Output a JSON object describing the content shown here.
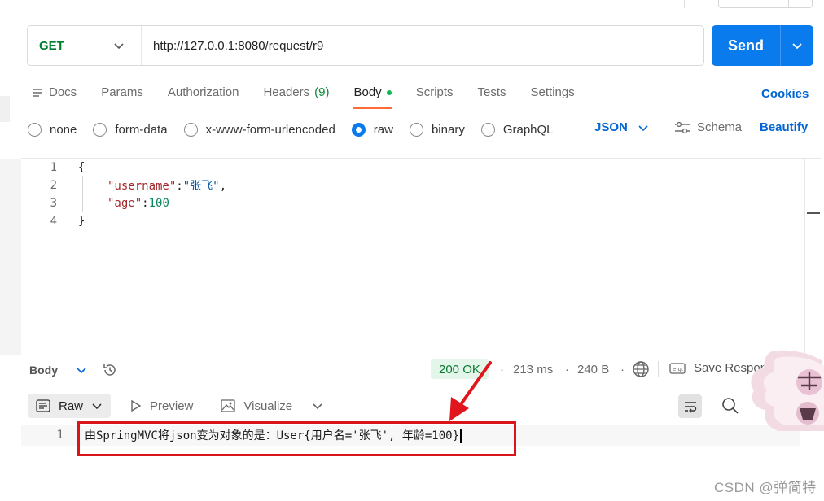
{
  "request": {
    "method": "GET",
    "url": "http://127.0.0.1:8080/request/r9",
    "send_label": "Send"
  },
  "tabs": {
    "docs": "Docs",
    "params": "Params",
    "authorization": "Authorization",
    "headers": "Headers",
    "headers_count": "(9)",
    "body": "Body",
    "scripts": "Scripts",
    "tests": "Tests",
    "settings": "Settings",
    "cookies": "Cookies"
  },
  "body_options": {
    "none": "none",
    "form_data": "form-data",
    "urlencoded": "x-www-form-urlencoded",
    "raw": "raw",
    "binary": "binary",
    "graphql": "GraphQL",
    "format": "JSON",
    "schema": "Schema",
    "beautify": "Beautify",
    "selected": "raw"
  },
  "editor": {
    "line_numbers": [
      "1",
      "2",
      "3",
      "4"
    ],
    "open_brace": "{",
    "close_brace": "}",
    "key1": "\"username\"",
    "value1": "\"张飞\"",
    "key2": "\"age\"",
    "value2": "100",
    "colon": ":",
    "comma": ","
  },
  "response": {
    "section_label": "Body",
    "status": "200 OK",
    "time": "213 ms",
    "size": "240 B",
    "save_label": "Save Respons",
    "view_raw": "Raw",
    "view_preview": "Preview",
    "view_visualize": "Visualize",
    "line_number": "1",
    "output": "由SpringMVC将json变为对象的是：User{用户名='张飞', 年龄=100}"
  },
  "watermark": "CSDN @弹简特",
  "colors": {
    "send": "#097bed",
    "accent_orange": "#ff6c37",
    "method_green": "#007f31",
    "annotation_red": "#d9151b"
  }
}
